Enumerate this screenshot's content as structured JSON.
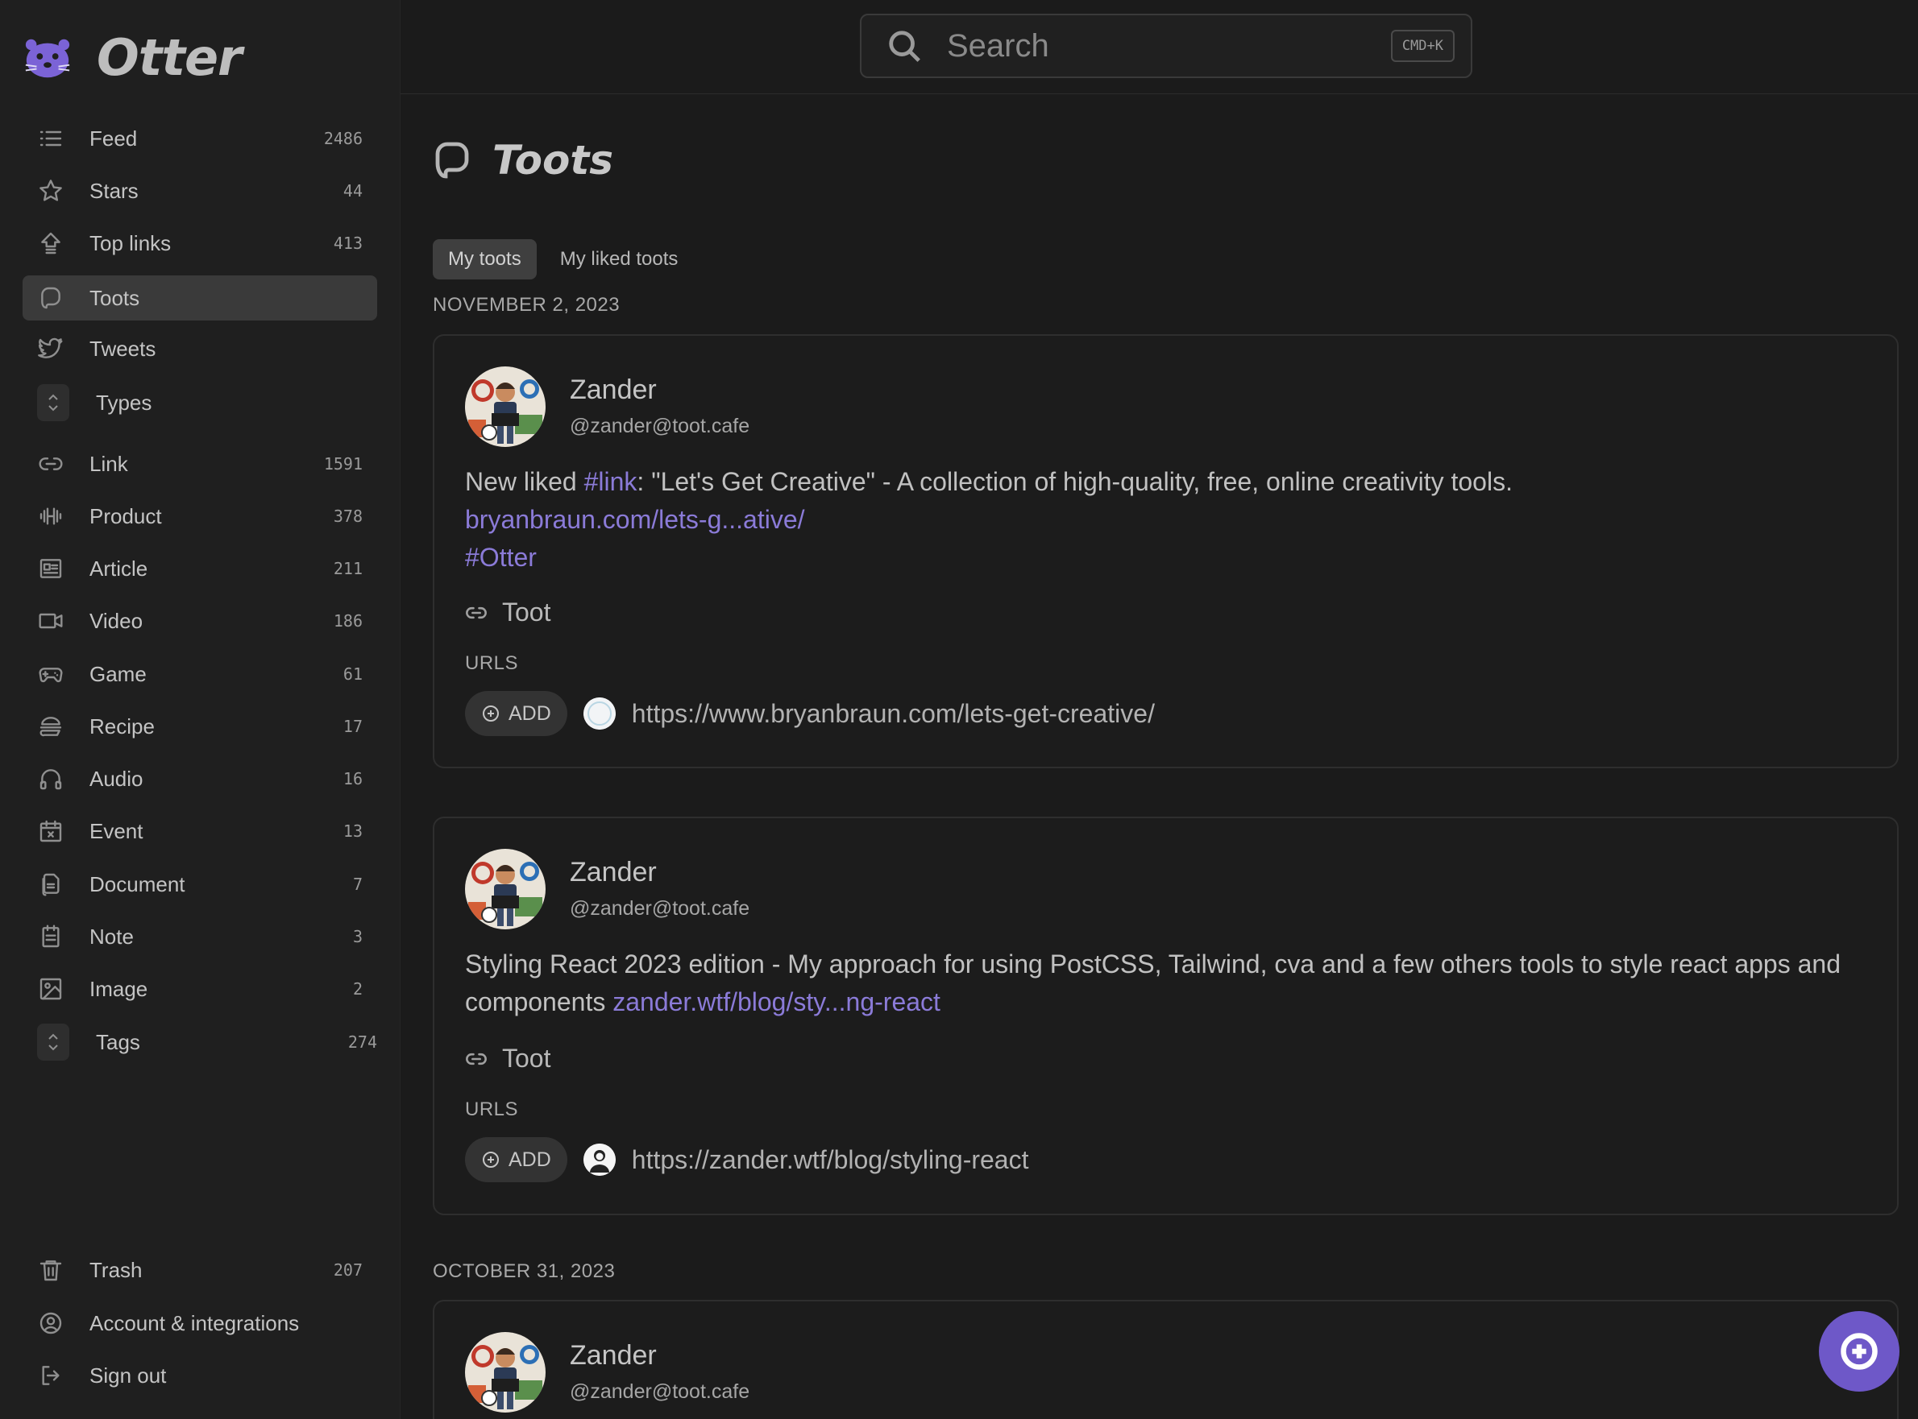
{
  "app": {
    "name": "Otter"
  },
  "search": {
    "placeholder": "Search",
    "shortcut": "CMD+K"
  },
  "sidebar": {
    "items": [
      {
        "label": "Feed",
        "count": "2486",
        "icon": "list-icon"
      },
      {
        "label": "Stars",
        "count": "44",
        "icon": "star-icon"
      },
      {
        "label": "Top links",
        "count": "413",
        "icon": "top-links-icon"
      },
      {
        "label": "Toots",
        "count": "",
        "icon": "mastodon-icon",
        "active": true
      },
      {
        "label": "Tweets",
        "count": "",
        "icon": "twitter-icon"
      }
    ],
    "types_label": "Types",
    "types": [
      {
        "label": "Link",
        "count": "1591",
        "icon": "link-icon"
      },
      {
        "label": "Product",
        "count": "378",
        "icon": "dumbbell-icon"
      },
      {
        "label": "Article",
        "count": "211",
        "icon": "article-icon"
      },
      {
        "label": "Video",
        "count": "186",
        "icon": "video-icon"
      },
      {
        "label": "Game",
        "count": "61",
        "icon": "gamepad-icon"
      },
      {
        "label": "Recipe",
        "count": "17",
        "icon": "burger-icon"
      },
      {
        "label": "Audio",
        "count": "16",
        "icon": "headphones-icon"
      },
      {
        "label": "Event",
        "count": "13",
        "icon": "calendar-x-icon"
      },
      {
        "label": "Document",
        "count": "7",
        "icon": "document-icon"
      },
      {
        "label": "Note",
        "count": "3",
        "icon": "note-icon"
      },
      {
        "label": "Image",
        "count": "2",
        "icon": "image-icon"
      }
    ],
    "tags": {
      "label": "Tags",
      "count": "274"
    },
    "bottom": [
      {
        "label": "Trash",
        "count": "207",
        "icon": "trash-icon"
      },
      {
        "label": "Account & integrations",
        "count": "",
        "icon": "user-circle-icon"
      },
      {
        "label": "Sign out",
        "count": "",
        "icon": "sign-out-icon"
      }
    ]
  },
  "page": {
    "title": "Toots",
    "tabs": [
      {
        "label": "My toots",
        "active": true
      },
      {
        "label": "My liked toots",
        "active": false
      }
    ]
  },
  "feed": {
    "groups": [
      {
        "date": "NOVEMBER 2, 2023"
      },
      {
        "date": "OCTOBER 31, 2023"
      }
    ],
    "toots": [
      {
        "author": "Zander",
        "handle": "@zander@toot.cafe",
        "text_prefix": "New liked ",
        "hashtag": "#link",
        "text_suffix": ": \"Let's Get Creative\" - A collection of high-quality, free, online creativity tools.",
        "link": "bryanbraun.com/lets-g...ative/",
        "tag": "#Otter",
        "type": "Toot",
        "urls_label": "URLS",
        "add_label": "ADD",
        "url": "https://www.bryanbraun.com/lets-get-creative/"
      },
      {
        "author": "Zander",
        "handle": "@zander@toot.cafe",
        "text": "Styling React 2023 edition - My approach for using PostCSS, Tailwind, cva and a few others tools to style react apps and components ",
        "link": "zander.wtf/blog/sty...ng-react",
        "type": "Toot",
        "urls_label": "URLS",
        "add_label": "ADD",
        "url": "https://zander.wtf/blog/styling-react"
      },
      {
        "author": "Zander",
        "handle": "@zander@toot.cafe"
      }
    ]
  },
  "colors": {
    "accent": "#6e58c8",
    "link": "#8b7bd8",
    "background": "#1b1b1b"
  }
}
